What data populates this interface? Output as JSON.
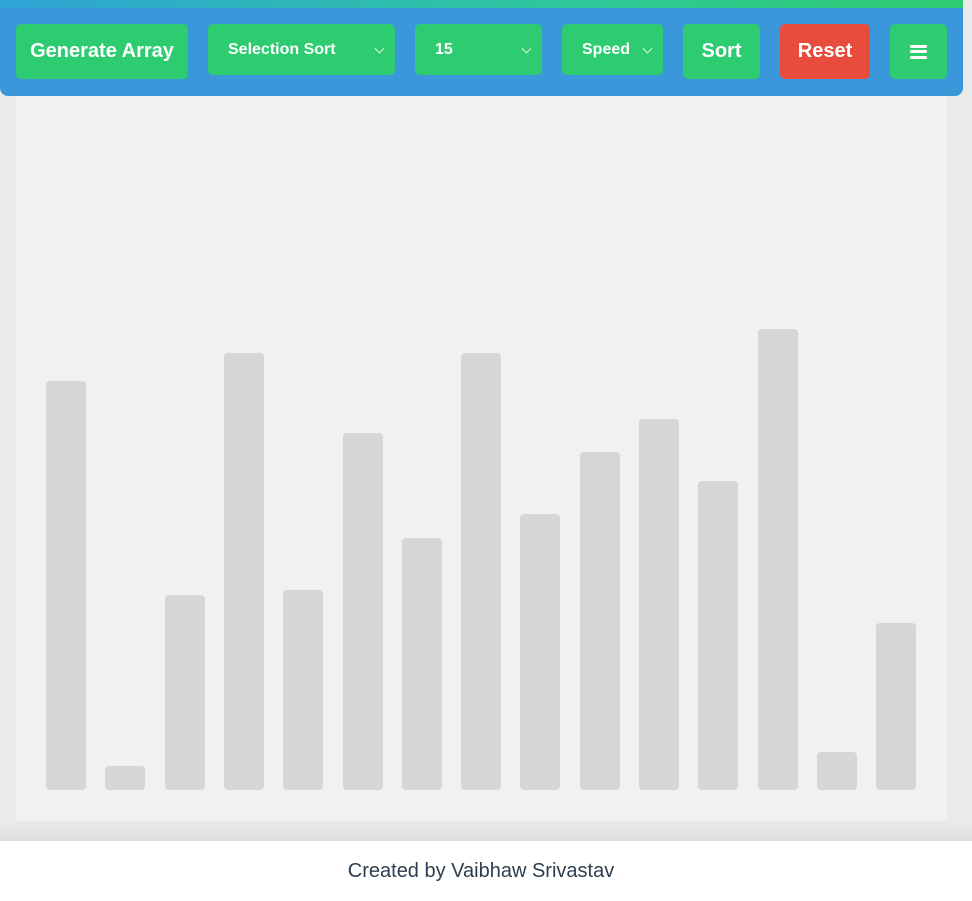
{
  "toolbar": {
    "generate_label": "Generate Array",
    "algorithm": "Selection Sort",
    "array_size": "15",
    "speed_label": "Speed",
    "sort_label": "Sort",
    "reset_label": "Reset"
  },
  "colors": {
    "toolbar": "#3a98da",
    "button": "#2ecc71",
    "reset": "#e74c3c",
    "bar": "#d6d6d6"
  },
  "chart_data": {
    "type": "bar",
    "values": [
      409,
      24,
      195,
      437,
      200,
      357,
      252,
      437,
      276,
      338,
      371,
      309,
      461,
      38,
      167
    ]
  },
  "footer": {
    "credit": "Created by Vaibhaw Srivastav"
  }
}
